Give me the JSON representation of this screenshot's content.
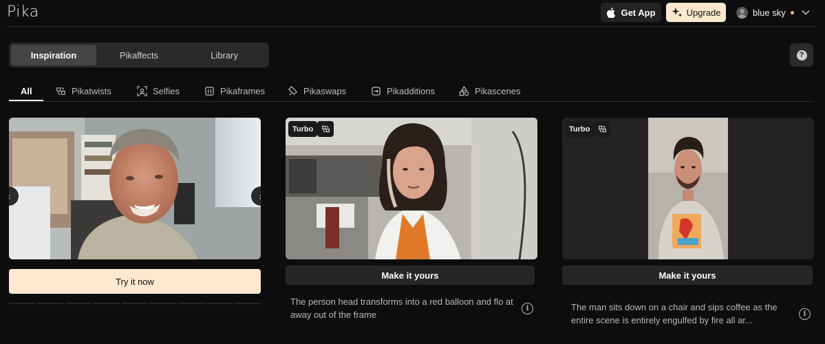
{
  "header": {
    "logo": "Pika",
    "get_app_label": "Get App",
    "upgrade_label": "Upgrade",
    "user_name": "blue sky"
  },
  "tabs": [
    {
      "label": "Inspiration",
      "active": true
    },
    {
      "label": "Pikaffects",
      "active": false
    },
    {
      "label": "Library",
      "active": false
    }
  ],
  "help_label": "?",
  "categories": [
    {
      "label": "All",
      "icon": "none",
      "active": true
    },
    {
      "label": "Pikatwists",
      "icon": "twist-icon"
    },
    {
      "label": "Selfies",
      "icon": "selfie-icon"
    },
    {
      "label": "Pikaframes",
      "icon": "frames-icon"
    },
    {
      "label": "Pikaswaps",
      "icon": "swap-icon"
    },
    {
      "label": "Pikadditions",
      "icon": "additions-icon"
    },
    {
      "label": "Pikascenes",
      "icon": "scenes-icon"
    }
  ],
  "cards": [
    {
      "cta": "Try it now",
      "prev_arrow": "‹",
      "next_arrow": "›"
    },
    {
      "badge": "Turbo",
      "cta": "Make it yours",
      "description": "The person head transforms into a red balloon and flo at away out of the frame"
    },
    {
      "badge": "Turbo",
      "cta": "Make it yours",
      "description": "The man sits down on a chair and sips coffee as the entire scene is entirely engulfed by fire all ar..."
    }
  ],
  "colors": {
    "background": "#0d0d0d",
    "accent_cream": "#fde9cf",
    "surface": "#262626",
    "status_dot": "#f1c27d"
  }
}
